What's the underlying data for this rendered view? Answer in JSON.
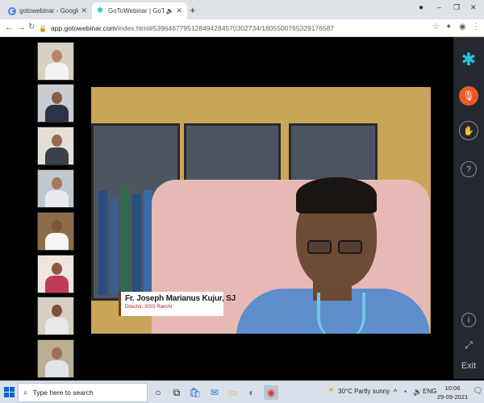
{
  "browser": {
    "tabs": [
      {
        "title": "gotowebinar - Google Search",
        "favicon": "google-g-icon"
      },
      {
        "title": "GoToWebinar | GoToWebinar",
        "favicon": "gotowebinar-icon",
        "active": true
      }
    ],
    "new_tab": "+",
    "window_controls": {
      "minimize": "–",
      "maximize": "❐",
      "close": "✕"
    },
    "url": {
      "host": "app.gotowebinar.com",
      "path": "/index.html#5396467795128494284570302734/1805500765329176587"
    }
  },
  "webinar": {
    "speaker": {
      "name": "Fr. Joseph Marianus Kujur, SJ",
      "role": "Director, XISS Ranchi"
    },
    "attendee_thumbnails": 8,
    "sidebar": {
      "exit_label": "Exit"
    }
  },
  "taskbar": {
    "search_placeholder": "Type here to search",
    "weather": "30°C  Partly sunny",
    "language": "ENG",
    "time": "10:06",
    "date": "29-09-2021"
  },
  "colors": {
    "accent": "#25c1e6",
    "mic": "#ee5a24",
    "sidebar": "#252830"
  }
}
